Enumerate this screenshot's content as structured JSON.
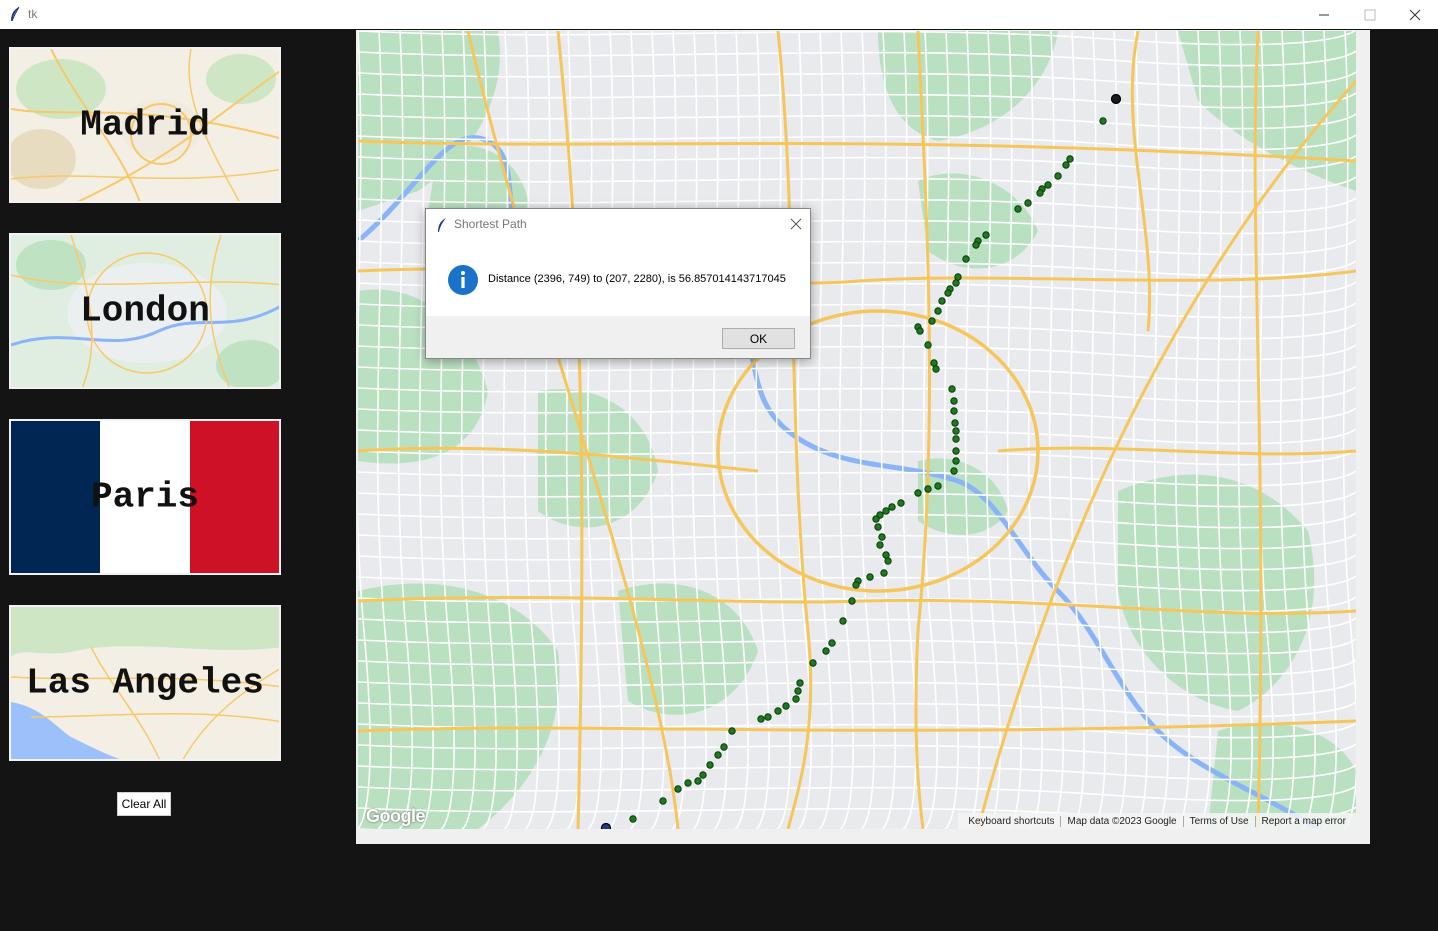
{
  "window": {
    "title": "tk"
  },
  "cities": [
    {
      "label": "Madrid"
    },
    {
      "label": "London"
    },
    {
      "label": "Paris"
    },
    {
      "label": "Las Angeles"
    }
  ],
  "clear_button_label": "Clear All",
  "map": {
    "logo": "Google",
    "attribution": [
      "Keyboard shortcuts",
      "Map data ©2023 Google",
      "Terms of Use",
      "Report a map error"
    ]
  },
  "dialog": {
    "title": "Shortest Path",
    "message": "Distance (2396, 749) to (207, 2280), is 56.857014143717045",
    "ok_label": "OK",
    "icon": "info-icon"
  },
  "colors": {
    "window_bg": "#141414",
    "route_dot": "#1e7a1e",
    "endpoint": "#1f3a8a",
    "france_blue": "#002654",
    "france_red": "#ce1126"
  }
}
